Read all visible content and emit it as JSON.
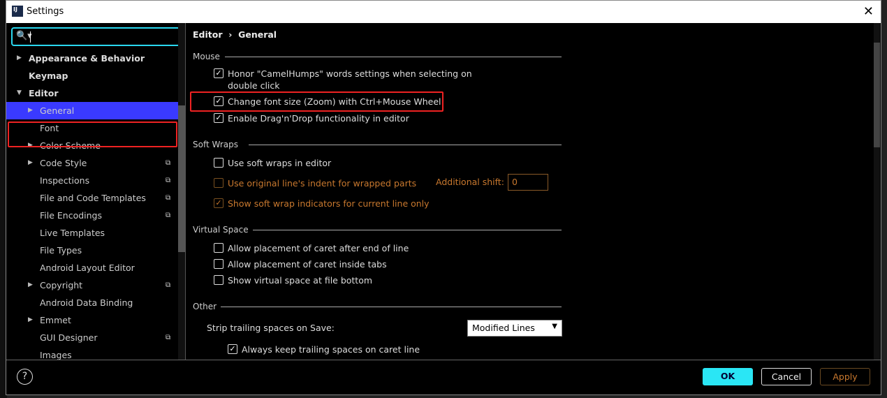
{
  "window": {
    "title": "Settings",
    "logo": "IJ"
  },
  "sidebar": {
    "search": {
      "value": "",
      "icon": "search-icon"
    },
    "items": [
      {
        "label": "Appearance & Behavior",
        "arrow": "right",
        "level": 0,
        "bold": true
      },
      {
        "label": "Keymap",
        "level": 0,
        "bold": true
      },
      {
        "label": "Editor",
        "arrow": "down",
        "level": 0,
        "bold": true
      },
      {
        "label": "General",
        "arrow": "right",
        "level": 1,
        "selected": true
      },
      {
        "label": "Font",
        "level": 1
      },
      {
        "label": "Color Scheme",
        "arrow": "right",
        "level": 1
      },
      {
        "label": "Code Style",
        "arrow": "right",
        "level": 1,
        "copy": true
      },
      {
        "label": "Inspections",
        "level": 1,
        "copy": true
      },
      {
        "label": "File and Code Templates",
        "level": 1,
        "copy": true
      },
      {
        "label": "File Encodings",
        "level": 1,
        "copy": true
      },
      {
        "label": "Live Templates",
        "level": 1
      },
      {
        "label": "File Types",
        "level": 1
      },
      {
        "label": "Android Layout Editor",
        "level": 1
      },
      {
        "label": "Copyright",
        "arrow": "right",
        "level": 1,
        "copy": true
      },
      {
        "label": "Android Data Binding",
        "level": 1
      },
      {
        "label": "Emmet",
        "arrow": "right",
        "level": 1
      },
      {
        "label": "GUI Designer",
        "level": 1,
        "copy": true
      },
      {
        "label": "Images",
        "level": 1
      }
    ]
  },
  "breadcrumb": {
    "a": "Editor",
    "sep": "›",
    "b": "General"
  },
  "sections": {
    "mouse": {
      "title": "Mouse",
      "items": [
        {
          "label": "Honor \"CamelHumps\" words settings when selecting on",
          "label2": "double click",
          "checked": true
        },
        {
          "label": "Change font size (Zoom) with Ctrl+Mouse Wheel",
          "checked": true
        },
        {
          "label": "Enable Drag'n'Drop functionality in editor",
          "checked": true
        }
      ]
    },
    "soft": {
      "title": "Soft Wraps",
      "items": [
        {
          "label": "Use soft wraps in editor",
          "checked": false
        },
        {
          "label": "Use original line's indent for wrapped parts",
          "checked": false,
          "disabled": true
        },
        {
          "label": "Show soft wrap indicators for current line only",
          "checked": true,
          "disabled": true
        }
      ],
      "shift_label": "Additional shift:",
      "shift_value": "0"
    },
    "virtual": {
      "title": "Virtual Space",
      "items": [
        {
          "label": "Allow placement of caret after end of line",
          "checked": false
        },
        {
          "label": "Allow placement of caret inside tabs",
          "checked": false
        },
        {
          "label": "Show virtual space at file bottom",
          "checked": false
        }
      ]
    },
    "other": {
      "title": "Other",
      "strip_label": "Strip trailing spaces on Save:",
      "strip_value": "Modified Lines",
      "items": [
        {
          "label": "Always keep trailing spaces on caret line",
          "checked": true
        }
      ]
    }
  },
  "buttons": {
    "help": "?",
    "ok": "OK",
    "cancel": "Cancel",
    "apply": "Apply"
  },
  "colors": {
    "accent": "#2ae6f5",
    "selection": "#3a3aff",
    "highlight": "#ee2222",
    "disabled": "#c8782e"
  }
}
